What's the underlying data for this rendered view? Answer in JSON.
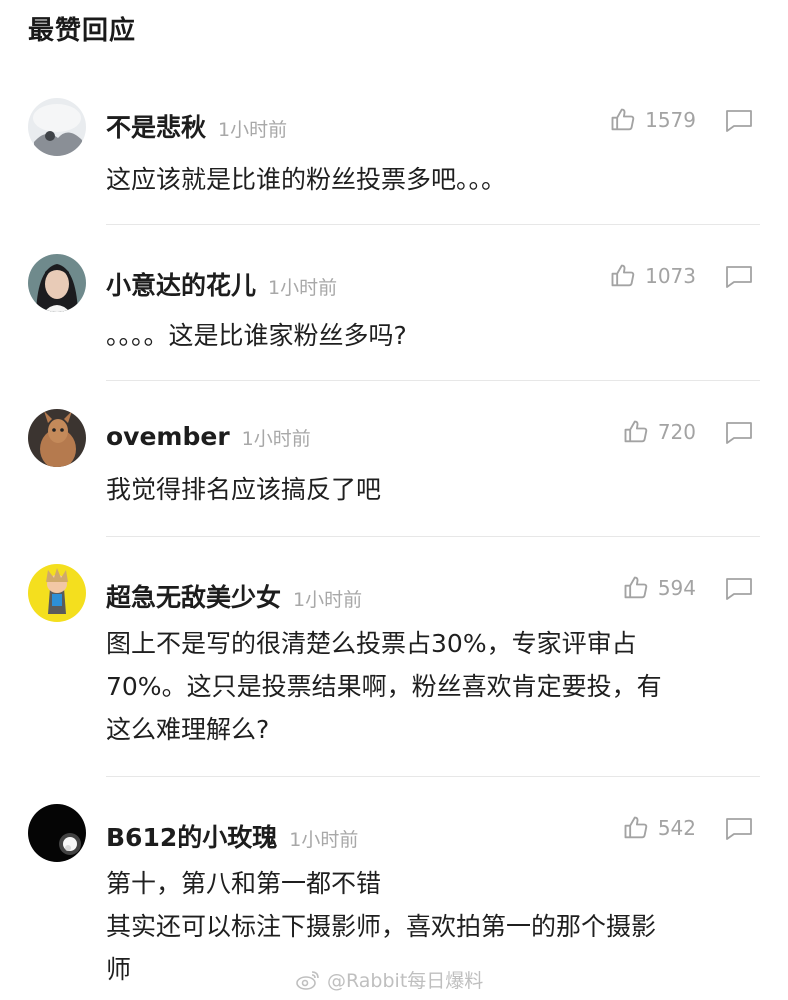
{
  "section_title": "最赞回应",
  "comments": [
    {
      "name": "不是悲秋",
      "time": "1小时前",
      "likes": "1579",
      "text": "这应该就是比谁的粉丝投票多吧。。。"
    },
    {
      "name": "小意达的花儿",
      "time": "1小时前",
      "likes": "1073",
      "text": "。。。。这是比谁家粉丝多吗?"
    },
    {
      "name": "ovember",
      "time": "1小时前",
      "likes": "720",
      "text": "我觉得排名应该搞反了吧"
    },
    {
      "name": "超急无敌美少女",
      "time": "1小时前",
      "likes": "594",
      "text": "图上不是写的很清楚么投票占30%，专家评审占\n70%。这只是投票结果啊，粉丝喜欢肯定要投，有\n这么难理解么?"
    },
    {
      "name": "B612的小玫瑰",
      "time": "1小时前",
      "likes": "542",
      "text": "第十，第八和第一都不错\n其实还可以标注下摄影师，喜欢拍第一的那个摄影\n师"
    }
  ],
  "watermark": "@Rabbit每日爆料",
  "icons": {
    "like": "thumbs-up-icon",
    "reply": "comment-bubble-icon",
    "watermark": "weibo-logo-icon"
  }
}
